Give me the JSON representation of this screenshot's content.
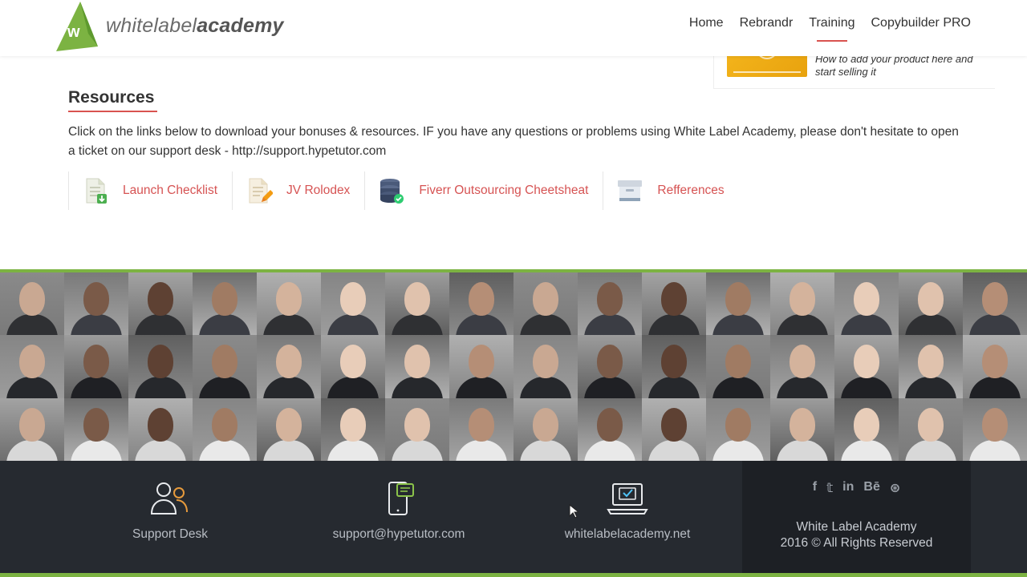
{
  "brand": {
    "logo_text_light": "whitelabel",
    "logo_text_bold": "academy",
    "accent_color": "#7cb342",
    "link_color": "#d65353"
  },
  "nav": {
    "items": [
      {
        "label": "Home",
        "active": false
      },
      {
        "label": "Rebrandr",
        "active": false
      },
      {
        "label": "Training",
        "active": true
      },
      {
        "label": "Copybuilder PRO",
        "active": false
      }
    ]
  },
  "video_card": {
    "title": "How to add your product here and start selling it"
  },
  "resources": {
    "heading": "Resources",
    "description": "Click on the links below to download your bonuses & resources. IF you have any questions or problems using White Label Academy, please don't hesitate to open a ticket on our support desk - http://support.hypetutor.com",
    "links": [
      {
        "label": "Launch Checklist",
        "icon": "document-download-icon"
      },
      {
        "label": "JV Rolodex",
        "icon": "document-pencil-icon"
      },
      {
        "label": "Fiverr Outsourcing Cheetsheat",
        "icon": "database-check-icon"
      },
      {
        "label": "Refferences",
        "icon": "archive-box-icon"
      }
    ]
  },
  "footer": {
    "support_label": "Support Desk",
    "email_label": "support@hypetutor.com",
    "site_label": "whitelabelacademy.net",
    "socials": [
      {
        "glyph": "f",
        "icon": "facebook-icon"
      },
      {
        "glyph": "𝕥",
        "icon": "twitter-icon"
      },
      {
        "glyph": "in",
        "icon": "linkedin-icon"
      },
      {
        "glyph": "Bē",
        "icon": "behance-icon"
      },
      {
        "glyph": "⊛",
        "icon": "dribbble-icon"
      }
    ],
    "copyright_line1": "White Label Academy",
    "copyright_line2": "2016 © All Rights Reserved"
  }
}
